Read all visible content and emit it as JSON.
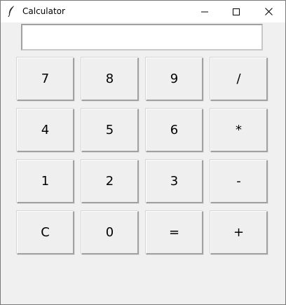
{
  "window": {
    "title": "Calculator"
  },
  "display": {
    "value": "",
    "placeholder": ""
  },
  "buttons": {
    "row1": [
      "7",
      "8",
      "9",
      "/"
    ],
    "row2": [
      "4",
      "5",
      "6",
      "*"
    ],
    "row3": [
      "1",
      "2",
      "3",
      "-"
    ],
    "row4": [
      "C",
      "0",
      "=",
      "+"
    ]
  },
  "icons": {
    "app": "feather-icon",
    "minimize": "minimize-icon",
    "maximize": "maximize-icon",
    "close": "close-icon"
  },
  "colors": {
    "window_bg": "#f0f0f0",
    "titlebar_bg": "#ffffff",
    "button_bg": "#efefef"
  }
}
